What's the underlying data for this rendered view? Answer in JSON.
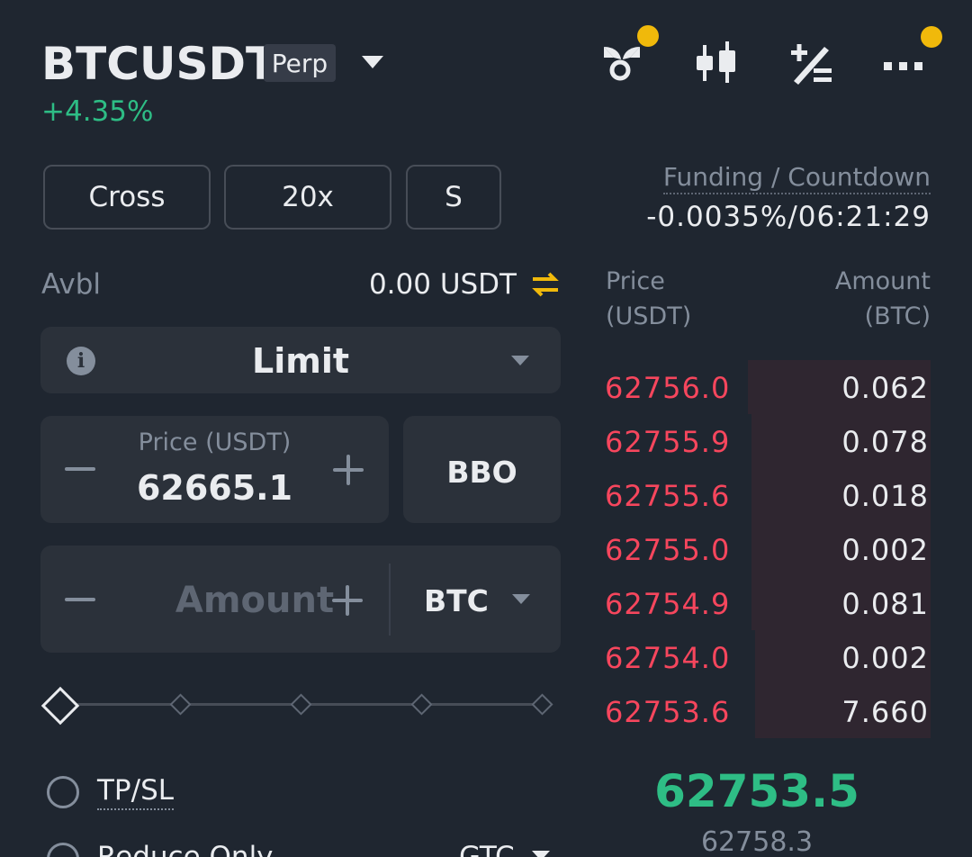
{
  "header": {
    "symbol": "BTCUSDT",
    "contract_type": "Perp",
    "change_percent": "+4.35%",
    "icons": [
      "gift-icon",
      "candlestick-icon",
      "calculator-icon",
      "more-icon"
    ]
  },
  "margin": {
    "mode": "Cross",
    "leverage": "20x",
    "asset_mode": "S"
  },
  "funding": {
    "label": "Funding / Countdown",
    "value": "-0.0035%/06:21:29"
  },
  "available": {
    "label": "Avbl",
    "value": "0.00 USDT"
  },
  "order_form": {
    "order_type": "Limit",
    "price_label": "Price (USDT)",
    "price_value": "62665.1",
    "bbo_label": "BBO",
    "amount_placeholder": "Amount",
    "amount_unit": "BTC",
    "slider_percent": 0
  },
  "options": {
    "tpsl_label": "TP/SL",
    "reduce_only_label": "Reduce Only",
    "time_in_force": "GTC"
  },
  "orderbook": {
    "price_header": [
      "Price",
      "(USDT)"
    ],
    "amount_header": [
      "Amount",
      "(BTC)"
    ],
    "asks": [
      {
        "price": "62756.0",
        "amount": "0.062",
        "depth": 0.56
      },
      {
        "price": "62755.9",
        "amount": "0.078",
        "depth": 0.55
      },
      {
        "price": "62755.6",
        "amount": "0.018",
        "depth": 0.55
      },
      {
        "price": "62755.0",
        "amount": "0.002",
        "depth": 0.55
      },
      {
        "price": "62754.9",
        "amount": "0.081",
        "depth": 0.55
      },
      {
        "price": "62754.0",
        "amount": "0.002",
        "depth": 0.54
      },
      {
        "price": "62753.6",
        "amount": "7.660",
        "depth": 0.54
      }
    ],
    "last_price": "62753.5",
    "mark_price": "62758.3"
  },
  "colors": {
    "background": "#1f2630",
    "panel": "#2b313a",
    "up": "#2ebd85",
    "down": "#f6465d",
    "accent": "#f0b90b",
    "muted": "#848e9c"
  }
}
